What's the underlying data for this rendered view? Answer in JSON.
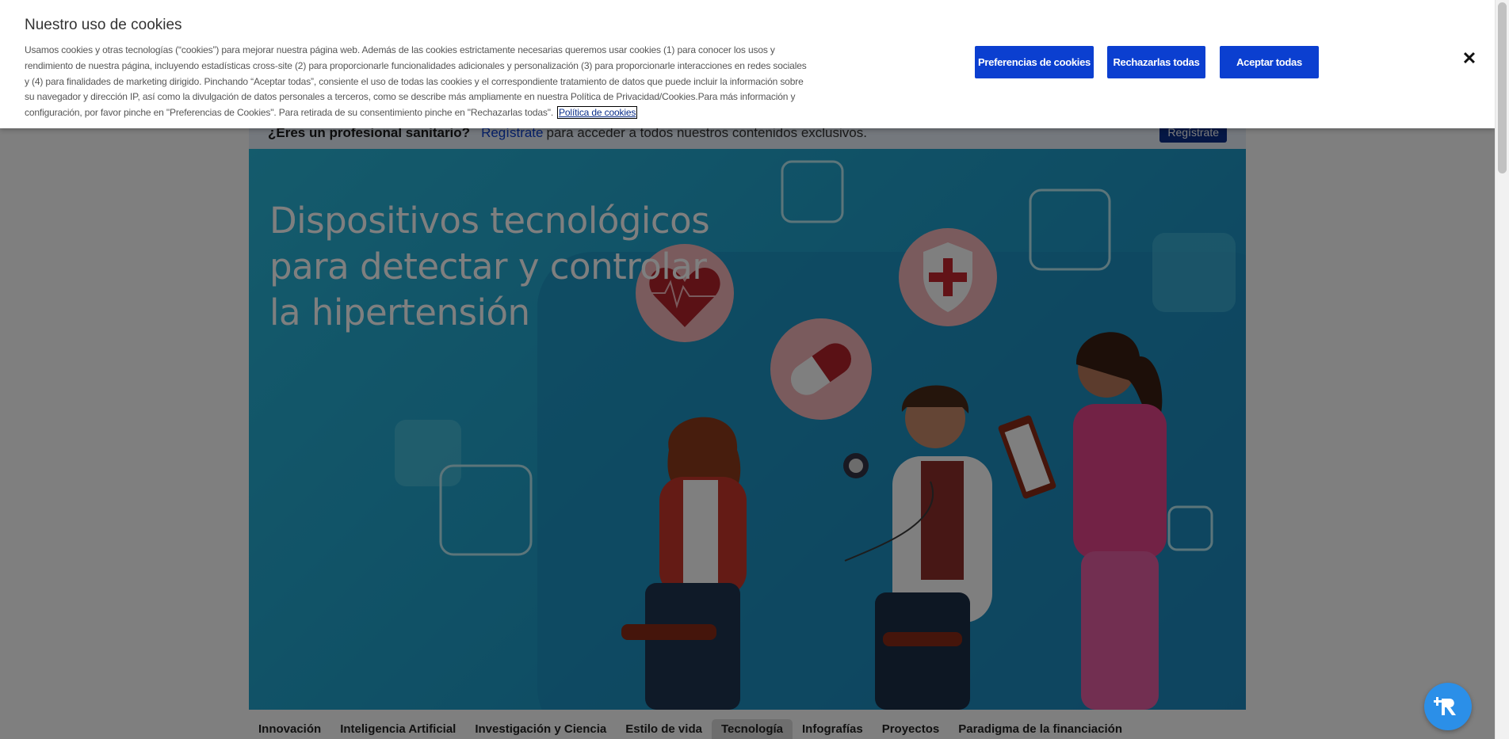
{
  "cookie_banner": {
    "title": "Nuestro uso de cookies",
    "body": "Usamos cookies y otras tecnologías (“cookies”) para mejorar nuestra página web. Además de las cookies estrictamente necesarias queremos usar cookies (1) para conocer los usos y rendimiento de nuestra página, incluyendo estadísticas cross-site (2) para proporcionarle funcionalidades adicionales y personalización (3) para proporcionarle interacciones en redes sociales y (4) para finalidades de marketing dirigido. Pinchando “Aceptar todas”, consiente el uso de todas las cookies y el correspondiente tratamiento de datos que puede incluir la información sobre su navegador y dirección IP, así como la divulgación de datos personales a terceros, como se describe más ampliamente en nuestra Política de Privacidad/Cookies.Para más información y configuración, por favor pinche en \"Preferencias de Cookies\". Para retirada de su consentimiento pinche en \"Rechazarlas todas\".",
    "policy_link": "Política de cookies",
    "preferences_button": "Preferencias de cookies",
    "reject_button": "Rechazarlas todas",
    "accept_button": "Aceptar todas",
    "close_icon": "close-icon"
  },
  "register_bar": {
    "question": "¿Eres un profesional sanitario?",
    "link": "Regístrate",
    "rest": "para acceder a todos nuestros contenidos exclusivos.",
    "button": "Regístrate"
  },
  "hero": {
    "title": "Dispositivos tecnológicos para detectar y controlar la hipertensión"
  },
  "nav": {
    "items": [
      "Innovación",
      "Inteligencia Artificial",
      "Investigación y Ciencia",
      "Estilo de vida",
      "Tecnología",
      "Infografías",
      "Proyectos",
      "Paradigma de la financiación"
    ],
    "active": "Tecnología"
  },
  "widget": {
    "icon": "accessibility-icon"
  },
  "colors": {
    "primary_button": "#0b3fd0",
    "hero_bg": "#1e9cc9"
  }
}
